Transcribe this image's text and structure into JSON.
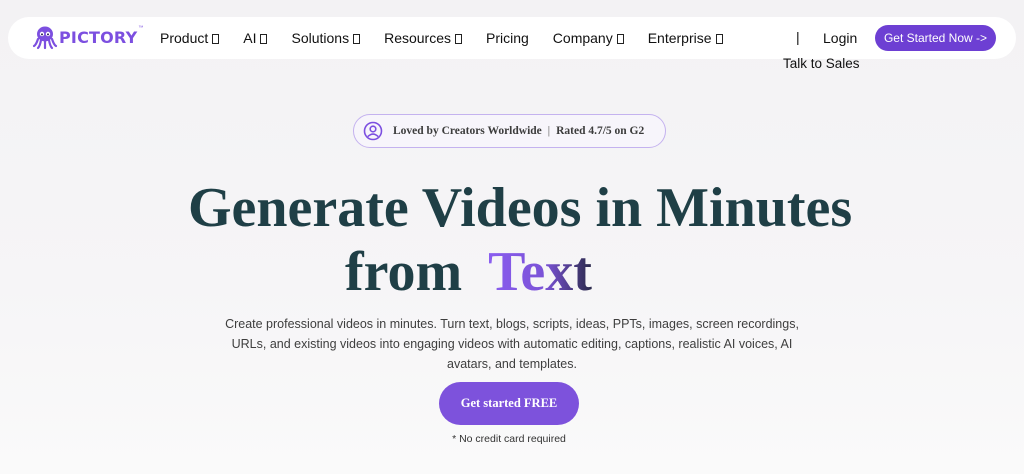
{
  "brand": {
    "name": "PICTORY",
    "tm": "™"
  },
  "nav": {
    "items": [
      {
        "label": "Product",
        "dropdown": true
      },
      {
        "label": "AI",
        "dropdown": true
      },
      {
        "label": "Solutions",
        "dropdown": true
      },
      {
        "label": "Resources",
        "dropdown": true
      },
      {
        "label": "Pricing",
        "dropdown": false
      },
      {
        "label": "Company",
        "dropdown": true
      },
      {
        "label": "Enterprise",
        "dropdown": true
      }
    ],
    "separator": "|",
    "login_label": "Login",
    "cta_label": "Get Started Now ->",
    "talk_sales_label": "Talk to Sales"
  },
  "badge": {
    "text": "Loved by Creators Worldwide",
    "separator": "|",
    "rating": "Rated 4.7/5 on G2"
  },
  "hero": {
    "headline_line1": "Generate Videos in Minutes",
    "headline_prefix": "from",
    "headline_accent": "Text",
    "description": "Create professional videos in minutes. Turn text, blogs, scripts, ideas, PPTs, images, screen recordings, URLs, and existing videos into engaging videos with automatic editing, captions, realistic AI voices, AI avatars, and templates.",
    "cta_label": "Get started FREE",
    "note": "* No credit card required"
  },
  "colors": {
    "brand_purple": "#6d3fd3",
    "cta_purple": "#7d52dc",
    "headline_teal": "#1f3f46"
  },
  "icons": {
    "logo": "octopus-logo-icon",
    "badge": "user-circle-icon",
    "dropdown": "missing-glyph-icon"
  }
}
